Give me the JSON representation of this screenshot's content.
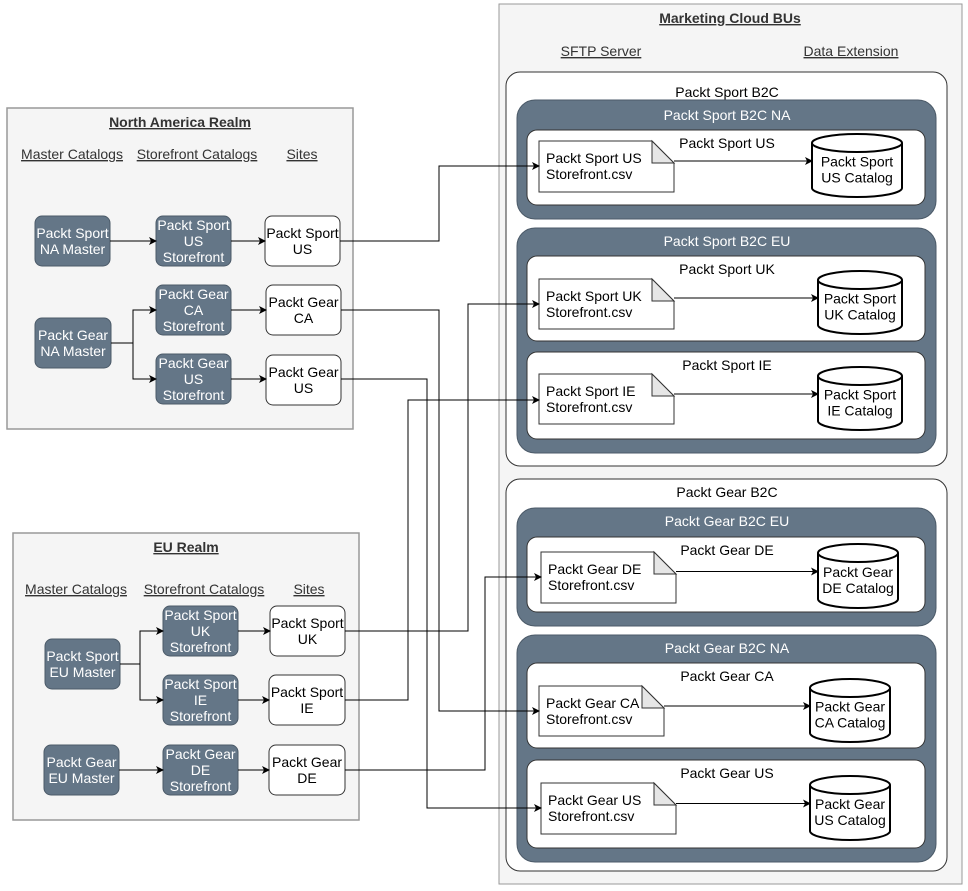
{
  "na_realm": {
    "title": "North America Realm",
    "headers": [
      "Master Catalogs",
      "Storefront Catalogs",
      "Sites"
    ]
  },
  "eu_realm": {
    "title": "EU Realm",
    "headers": [
      "Master Catalogs",
      "Storefront Catalogs",
      "Sites"
    ]
  },
  "marketing_cloud": {
    "title": "Marketing Cloud BUs",
    "headers": [
      "SFTP Server",
      "Data Extension"
    ]
  },
  "nodes": {
    "na_sport_master": [
      "Packt Sport",
      "NA Master"
    ],
    "na_sport_us_sf": [
      "Packt Sport",
      "US",
      "Storefront"
    ],
    "na_sport_us_site": [
      "Packt Sport",
      "US"
    ],
    "na_gear_master": [
      "Packt Gear",
      "NA Master"
    ],
    "na_gear_ca_sf": [
      "Packt Gear",
      "CA",
      "Storefront"
    ],
    "na_gear_ca_site": [
      "Packt Gear",
      "CA"
    ],
    "na_gear_us_sf": [
      "Packt Gear",
      "US",
      "Storefront"
    ],
    "na_gear_us_site": [
      "Packt Gear",
      "US"
    ],
    "eu_sport_master": [
      "Packt Sport",
      "EU Master"
    ],
    "eu_sport_uk_sf": [
      "Packt Sport",
      "UK",
      "Storefront"
    ],
    "eu_sport_uk_site": [
      "Packt Sport",
      "UK"
    ],
    "eu_sport_ie_sf": [
      "Packt Sport",
      "IE",
      "Storefront"
    ],
    "eu_sport_ie_site": [
      "Packt Sport",
      "IE"
    ],
    "eu_gear_master": [
      "Packt Gear",
      "EU Master"
    ],
    "eu_gear_de_sf": [
      "Packt Gear",
      "DE",
      "Storefront"
    ],
    "eu_gear_de_site": [
      "Packt Gear",
      "DE"
    ]
  },
  "bus": {
    "sport_b2c": "Packt Sport B2C",
    "sport_b2c_na": "Packt Sport B2C NA",
    "sport_us": "Packt Sport US",
    "sport_b2c_eu": "Packt Sport B2C EU",
    "sport_uk": "Packt Sport UK",
    "sport_ie": "Packt Sport IE",
    "gear_b2c": "Packt Gear B2C",
    "gear_b2c_eu": "Packt Gear B2C EU",
    "gear_de": "Packt Gear DE",
    "gear_b2c_na": "Packt Gear B2C NA",
    "gear_ca": "Packt Gear CA",
    "gear_us": "Packt Gear US"
  },
  "files": {
    "sport_us": [
      "Packt Sport US",
      "Storefront.csv"
    ],
    "sport_uk": [
      "Packt Sport UK",
      "Storefront.csv"
    ],
    "sport_ie": [
      "Packt Sport IE",
      "Storefront.csv"
    ],
    "gear_de": [
      "Packt Gear DE",
      "Storefront.csv"
    ],
    "gear_ca": [
      "Packt Gear CA",
      "Storefront.csv"
    ],
    "gear_us": [
      "Packt Gear US",
      "Storefront.csv"
    ]
  },
  "catalogs": {
    "sport_us": [
      "Packt Sport",
      "US Catalog"
    ],
    "sport_uk": [
      "Packt Sport",
      "UK Catalog"
    ],
    "sport_ie": [
      "Packt Sport",
      "IE Catalog"
    ],
    "gear_de": [
      "Packt Gear",
      "DE Catalog"
    ],
    "gear_ca": [
      "Packt Gear",
      "CA Catalog"
    ],
    "gear_us": [
      "Packt Gear",
      "US Catalog"
    ]
  },
  "colors": {
    "dark_fill": "#647687",
    "realm_fill": "#f5f5f5"
  }
}
